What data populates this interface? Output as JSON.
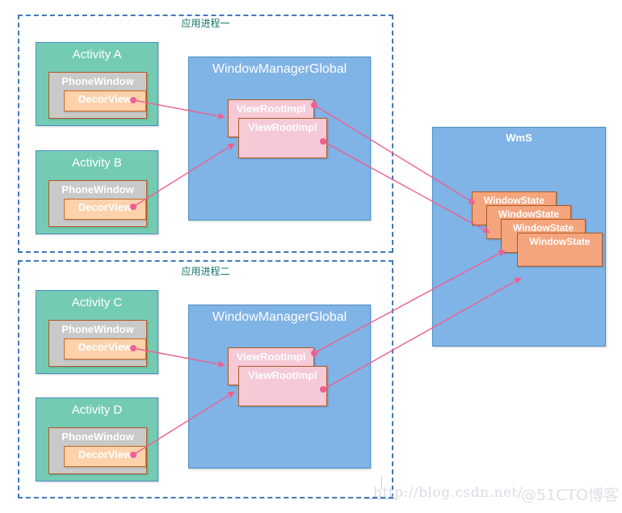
{
  "diagram": {
    "title_hidden": "",
    "colors": {
      "activity_fill": "#74cbb4",
      "phonewindow_fill": "#c9c9c9",
      "decorview_fill": "#fdd2ab",
      "wmg_fill": "#80b3e6",
      "wms_fill": "#80b3e6",
      "viewrootimpl_fill": "#f5c9d5",
      "windowstate_fill": "#f4a57d",
      "connector": "#ee5f92",
      "process_border": "#4179b8",
      "process_title": "#17756b"
    }
  },
  "processes": [
    {
      "id": "p1",
      "title": "应用进程一"
    },
    {
      "id": "p2",
      "title": "应用进程二"
    }
  ],
  "labels": {
    "phone_window": "PhoneWindow",
    "decor_view": "DecorView",
    "window_manager_global": "WindowManagerGlobal",
    "view_root_impl": "ViewRootImpl",
    "wms": "WmS",
    "window_state": "WindowState"
  },
  "activities": [
    {
      "id": "a",
      "name": "Activity A",
      "process": "p1"
    },
    {
      "id": "b",
      "name": "Activity B",
      "process": "p1"
    },
    {
      "id": "c",
      "name": "Activity C",
      "process": "p2"
    },
    {
      "id": "d",
      "name": "Activity D",
      "process": "p2"
    }
  ],
  "window_manager_globals": [
    {
      "process": "p1",
      "label": "WindowManagerGlobal",
      "view_roots": [
        "ViewRootImpl",
        "ViewRootImpl"
      ]
    },
    {
      "process": "p2",
      "label": "WindowManagerGlobal",
      "view_roots": [
        "ViewRootImpl",
        "ViewRootImpl"
      ]
    }
  ],
  "wms": {
    "label": "WmS",
    "window_states": [
      "WindowState",
      "WindowState",
      "WindowState",
      "WindowState"
    ]
  },
  "watermark": {
    "url": "http://blog.csdn.net/",
    "site": "@51CTO博客"
  }
}
